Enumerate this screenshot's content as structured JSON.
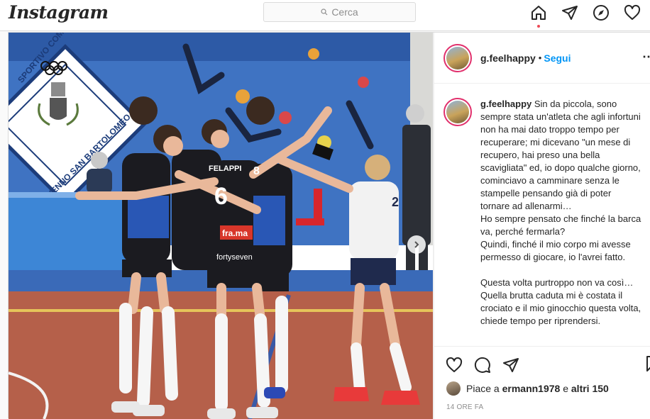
{
  "app": {
    "logo": "Instagram"
  },
  "search": {
    "placeholder": "Cerca"
  },
  "nav": [
    "home-icon",
    "direct-icon",
    "explore-icon",
    "activity-icon"
  ],
  "post": {
    "username": "g.feelhappy",
    "separator": "•",
    "follow_label": "Segui",
    "caption_user": "g.feelhappy",
    "caption": "Sin da piccola, sono sempre stata un'atleta che agli infortuni non ha mai dato troppo tempo per recuperare; mi dicevano \"un mese di recupero, hai preso una bella scavigliata\" ed, io dopo qualche giorno, cominciavo a camminare senza le stampelle pensando già di poter tornare ad allenarmi…\nHo sempre pensato che finché la barca va, perché fermarla?\nQuindi, finché il mio corpo mi avesse permesso di giocare, io l'avrei fatto.\n\nQuesta volta purtroppo non va così…\nQuella brutta caduta mi è costata il crociato e il mio ginocchio questa volta, chiede tempo per riprendersi.",
    "likes_prefix": "Piace a",
    "likes_user": "ermann1978",
    "likes_mid": "e",
    "likes_others": "altri 150",
    "time": "14 ORE FA"
  },
  "photo": {
    "banner_text": "SPORTIVO COMUNALE",
    "banner_arc": "VENNO SAN BARTOLOMEO",
    "jersey_name": "FELAPPI",
    "jersey_number": "6",
    "jersey_number_2": "8",
    "jersey_number_3": "2",
    "sponsor": "fortyseven",
    "sponsor_logo": "fra.ma"
  },
  "colors": {
    "accent": "#0095f6",
    "notify": "#ed4956",
    "border": "#dbdbdb"
  }
}
